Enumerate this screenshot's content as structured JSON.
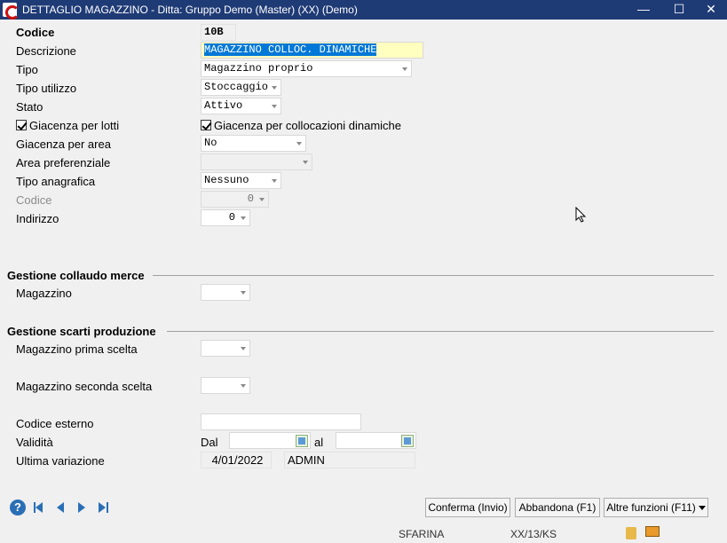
{
  "window": {
    "title": "DETTAGLIO MAGAZZINO - Ditta: Gruppo Demo (Master) (XX)  (Demo)"
  },
  "form": {
    "codice": {
      "label": "Codice",
      "value": "10B"
    },
    "descrizione": {
      "label": "Descrizione",
      "value": "MAGAZZINO COLLOC. DINAMICHE"
    },
    "tipo": {
      "label": "Tipo",
      "value": "Magazzino proprio"
    },
    "tipo_utilizzo": {
      "label": "Tipo utilizzo",
      "value": "Stoccaggio"
    },
    "stato": {
      "label": "Stato",
      "value": "Attivo"
    },
    "giacenza_lotti": {
      "label": "Giacenza per lotti",
      "checked": true
    },
    "giacenza_collocazioni": {
      "label": "Giacenza per collocazioni dinamiche",
      "checked": true
    },
    "giacenza_area": {
      "label": "Giacenza per area",
      "value": "No"
    },
    "area_preferenziale": {
      "label": "Area preferenziale",
      "value": ""
    },
    "tipo_anagrafica": {
      "label": "Tipo anagrafica",
      "value": "Nessuno"
    },
    "codice_anagrafica": {
      "label": "Codice",
      "value": "0"
    },
    "indirizzo": {
      "label": "Indirizzo",
      "value": "0"
    }
  },
  "collaudo": {
    "title": "Gestione collaudo merce",
    "magazzino": {
      "label": "Magazzino",
      "value": ""
    }
  },
  "scarti": {
    "title": "Gestione scarti produzione",
    "prima": {
      "label": "Magazzino prima scelta",
      "value": ""
    },
    "seconda": {
      "label": "Magazzino seconda scelta",
      "value": ""
    }
  },
  "extra": {
    "codice_esterno": {
      "label": "Codice esterno",
      "value": ""
    },
    "validita": {
      "label": "Validità",
      "dal_label": "Dal",
      "al_label": "al",
      "dal_value": "",
      "al_value": ""
    },
    "ultima_variazione": {
      "label": "Ultima variazione",
      "date": "4/01/2022",
      "user": "ADMIN"
    }
  },
  "buttons": {
    "conferma": "Conferma (Invio)",
    "abbandona": "Abbandona (F1)",
    "altre": "Altre funzioni (F11)"
  },
  "status": {
    "user": "SFARINA",
    "code": "XX/13/KS"
  },
  "nav_icons": [
    "help-icon",
    "first-record-icon",
    "previous-record-icon",
    "next-record-icon",
    "last-record-icon"
  ]
}
